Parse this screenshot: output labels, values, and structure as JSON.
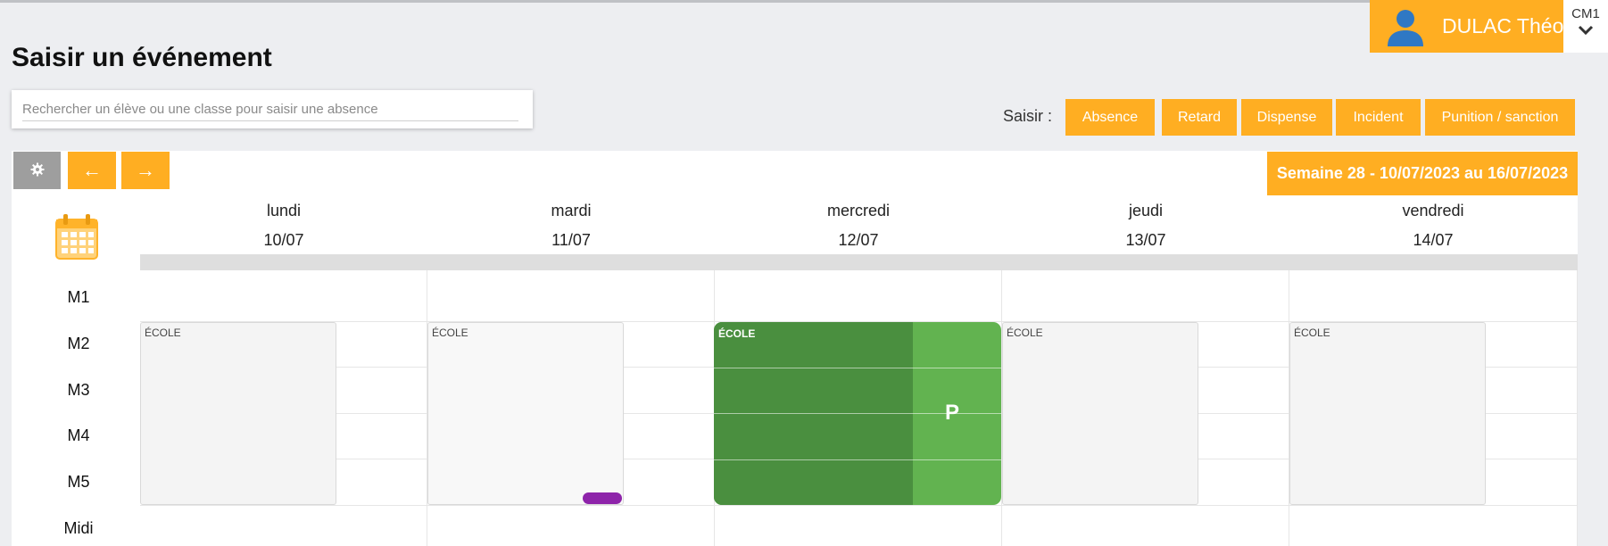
{
  "user": {
    "name": "DULAC Théo",
    "class": "CM1",
    "avatar_icon": "user-silhouette-icon",
    "chevron_icon": "chevron-down-icon"
  },
  "page": {
    "title": "Saisir un événement"
  },
  "search": {
    "placeholder": "Rechercher un élève ou une classe pour saisir une absence",
    "value": ""
  },
  "saisir": {
    "label": "Saisir :",
    "buttons": [
      "Absence",
      "Retard",
      "Dispense",
      "Incident",
      "Punition / sanction"
    ]
  },
  "toolbar": {
    "settings_icon": "gear-icon",
    "prev_label": "←",
    "next_label": "→"
  },
  "week": {
    "label": "Semaine 28 - 10/07/2023 au 16/07/2023"
  },
  "days": [
    {
      "name": "lundi",
      "date": "10/07"
    },
    {
      "name": "mardi",
      "date": "11/07"
    },
    {
      "name": "mercredi",
      "date": "12/07"
    },
    {
      "name": "jeudi",
      "date": "13/07"
    },
    {
      "name": "vendredi",
      "date": "14/07"
    }
  ],
  "slots": [
    "M1",
    "M2",
    "M3",
    "M4",
    "M5",
    "Midi"
  ],
  "events": {
    "ecole_label": "ÉCOLE",
    "present_mark": "P"
  },
  "colors": {
    "accent": "#ffae22",
    "present_green": "#62b350",
    "present_dark": "#4a8f3f",
    "marker_purple": "#8e24aa",
    "settings_gray": "#9e9e9e"
  }
}
